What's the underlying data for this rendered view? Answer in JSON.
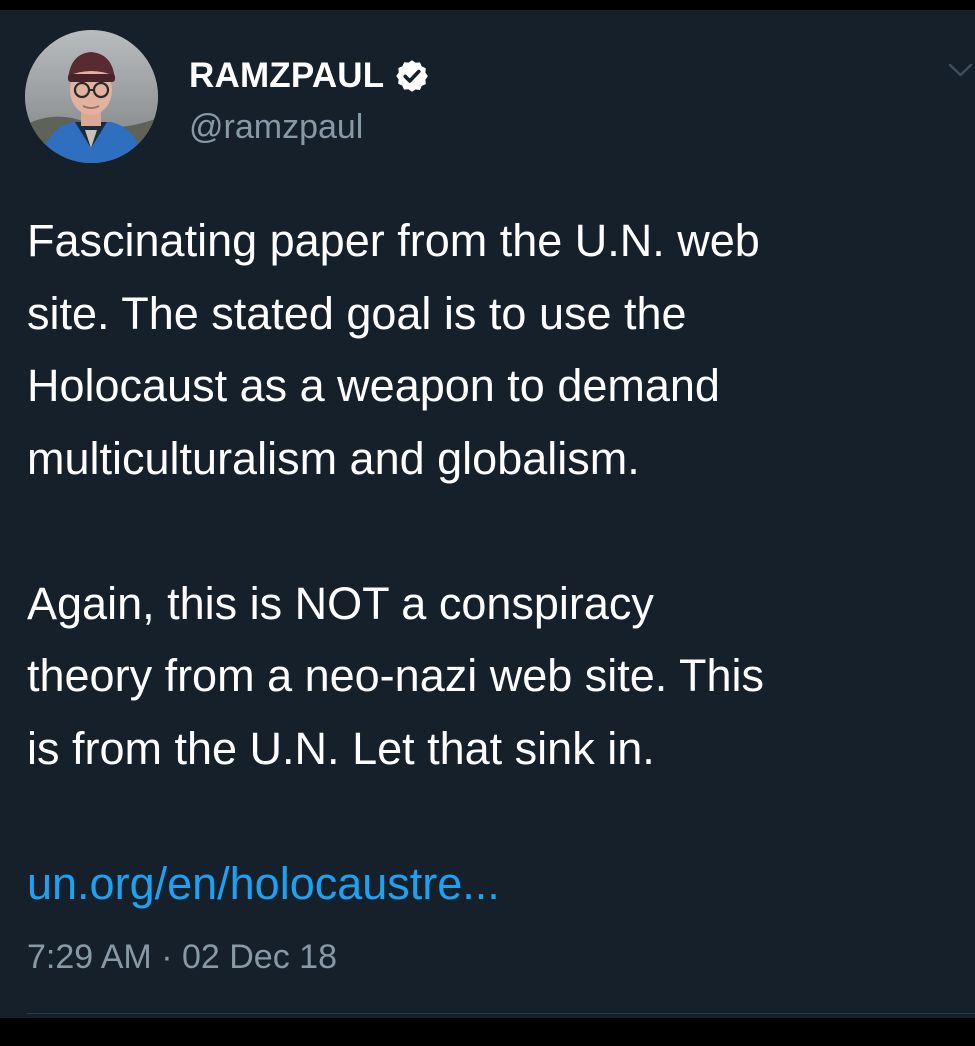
{
  "tweet": {
    "author": {
      "display_name": "RAMZPAUL",
      "handle": "@ramzpaul",
      "verified": true,
      "avatar_icon": "profile-photo"
    },
    "text_lines": [
      "Fascinating paper from the U.N. web",
      "site. The stated goal is to use the",
      "Holocaust as a weapon to demand",
      "multiculturalism and globalism.",
      "",
      "Again, this is NOT a conspiracy",
      "theory from a neo-nazi web site. This",
      "is from the U.N. Let that sink in."
    ],
    "link": "un.org/en/holocaustre...",
    "time": "7:29 AM",
    "separator": "·",
    "date": "02 Dec 18"
  },
  "icons": {
    "verified": "verified-badge-icon",
    "menu": "chevron-down-icon"
  },
  "colors": {
    "background": "#15202b",
    "text": "#ffffff",
    "secondary_text": "#8899a6",
    "link": "#1da1f2"
  }
}
